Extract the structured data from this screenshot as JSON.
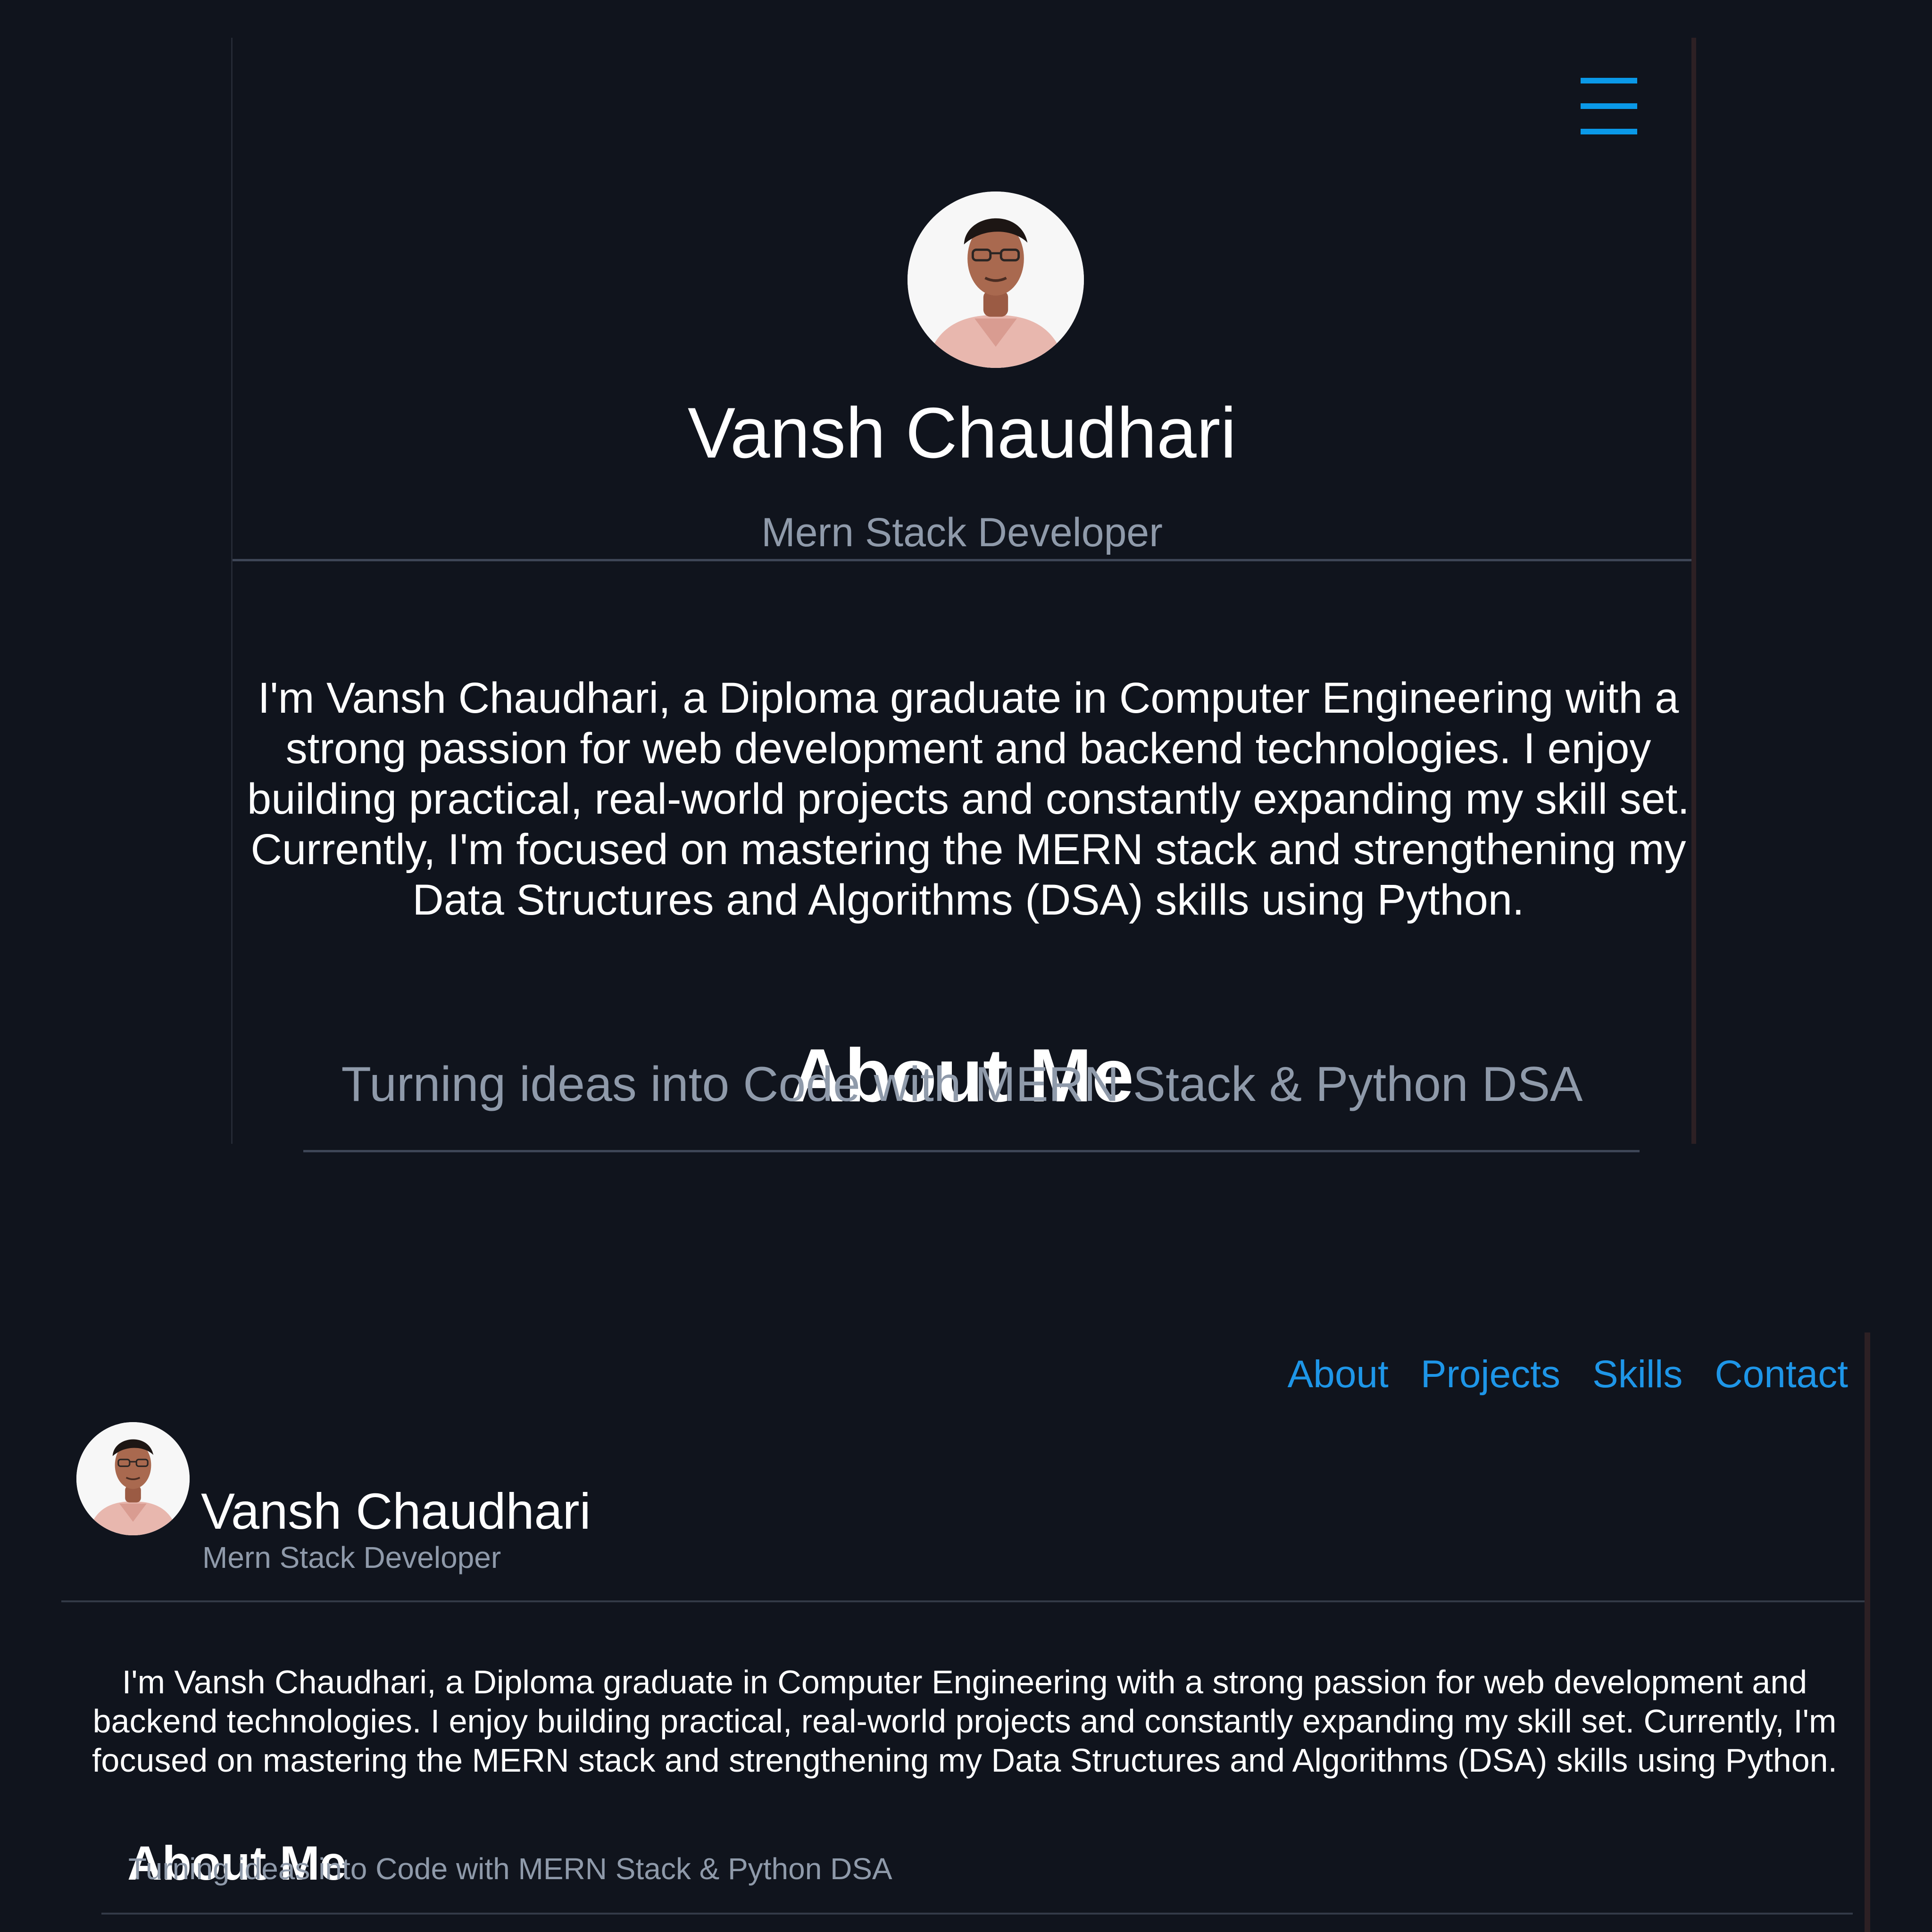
{
  "colors": {
    "background": "#10141d",
    "accent": "#1e96e8",
    "muted_text": "#8f9aaa",
    "divider": "#3e4656"
  },
  "mobile": {
    "menu_icon": "hamburger-menu-icon",
    "profile": {
      "avatar_icon": "profile-photo",
      "name": "Vansh Chaudhari",
      "role": "Mern Stack Developer"
    },
    "bio": "I'm Vansh Chaudhari, a Diploma graduate in Computer Engineering with a strong passion for web development and backend technologies. I enjoy building practical, real-world projects and constantly expanding my skill set. Currently, I'm focused on mastering the MERN stack and strengthening my Data Structures and Algorithms (DSA) skills using Python.",
    "about": {
      "title": "About Me",
      "subtitle": "Turning ideas into Code with MERN Stack & Python DSA"
    }
  },
  "desktop": {
    "nav": [
      {
        "label": "About"
      },
      {
        "label": "Projects"
      },
      {
        "label": "Skills"
      },
      {
        "label": "Contact"
      }
    ],
    "profile": {
      "avatar_icon": "profile-photo",
      "name": "Vansh Chaudhari",
      "role": "Mern Stack Developer"
    },
    "bio": "I'm Vansh Chaudhari, a Diploma graduate in Computer Engineering with a strong passion for web development and backend technologies. I enjoy building practical, real-world projects and constantly expanding my skill set. Currently, I'm focused on mastering the MERN stack and strengthening my Data Structures and Algorithms (DSA) skills using Python.",
    "about": {
      "title": "About Me",
      "subtitle": "Turning ideas into Code with MERN Stack & Python DSA"
    }
  }
}
